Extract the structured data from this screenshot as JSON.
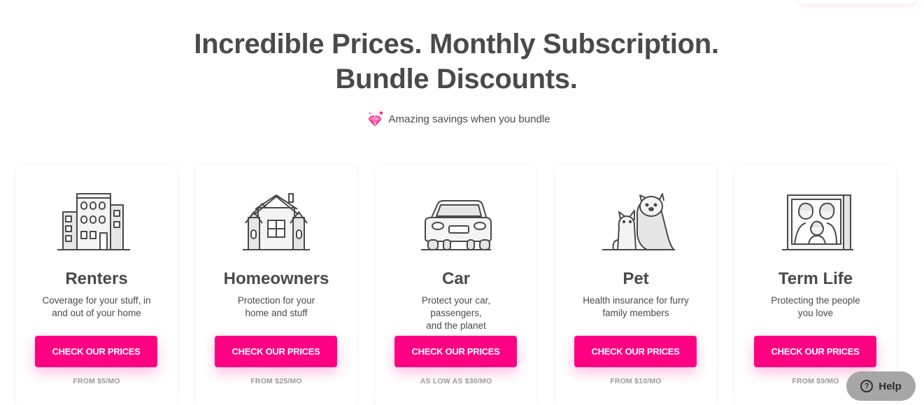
{
  "header": {
    "headline_line1": "Incredible Prices. Monthly Subscription.",
    "headline_line2": "Bundle Discounts.",
    "savings_text": "Amazing savings when you bundle",
    "savings_icon": "diamond-icon"
  },
  "colors": {
    "brand_pink": "#ff0083",
    "text_dark": "#4a4a4a",
    "text_muted": "#9b9b9b",
    "help_bg": "#a6a6a6"
  },
  "cards": [
    {
      "icon": "apartment-building-icon",
      "title": "Renters",
      "desc_line1": "Coverage for your stuff, in",
      "desc_line2": "and out of your home",
      "cta": "CHECK OUR PRICES",
      "price": "FROM $5/MO"
    },
    {
      "icon": "house-icon",
      "title": "Homeowners",
      "desc_line1": "Protection for your",
      "desc_line2": "home and stuff",
      "cta": "CHECK OUR PRICES",
      "price": "FROM $25/MO"
    },
    {
      "icon": "car-icon",
      "title": "Car",
      "desc_line1": "Protect your car, passengers,",
      "desc_line2": "and the planet",
      "cta": "CHECK OUR PRICES",
      "price": "AS LOW AS $30/MO"
    },
    {
      "icon": "cat-and-dog-icon",
      "title": "Pet",
      "desc_line1": "Health insurance for furry",
      "desc_line2": "family members",
      "cta": "CHECK OUR PRICES",
      "price": "FROM $10/MO"
    },
    {
      "icon": "family-portrait-icon",
      "title": "Term Life",
      "desc_line1": "Protecting the people",
      "desc_line2": "you love",
      "cta": "CHECK OUR PRICES",
      "price": "FROM $9/MO"
    }
  ],
  "help": {
    "label": "Help",
    "icon": "question-circle-icon"
  }
}
